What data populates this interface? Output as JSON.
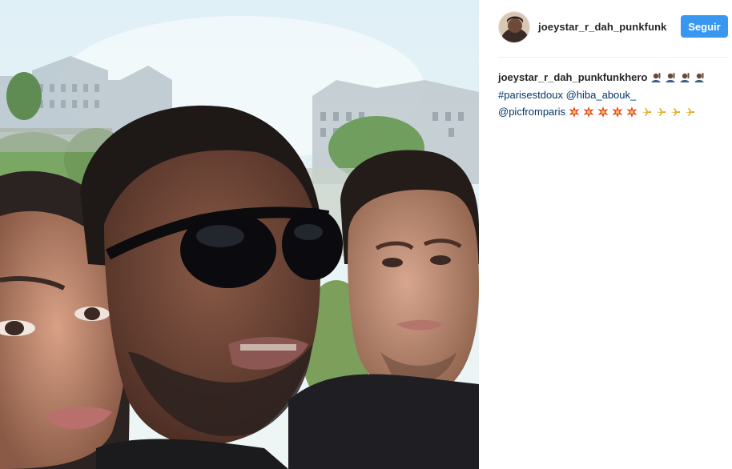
{
  "post": {
    "username": "joeystar_r_dah_punkfunk",
    "follow_label": "Seguir"
  },
  "caption": {
    "author": "joeystar_r_dah_punkfunkhero",
    "hashtag": "#parisestdoux",
    "mention_1": "@hiba_abouk_",
    "mention_2": "@picfromparis"
  },
  "emojis": {
    "line1": [
      "person-raising-hand",
      "person-raising-hand",
      "person-raising-hand",
      "person-raising-hand"
    ],
    "line3": [
      "collision",
      "collision",
      "collision",
      "collision",
      "collision",
      "airplane",
      "airplane",
      "airplane",
      "airplane"
    ]
  },
  "colors": {
    "follow_button": "#3897f0",
    "link": "#003569",
    "text": "#262626"
  }
}
